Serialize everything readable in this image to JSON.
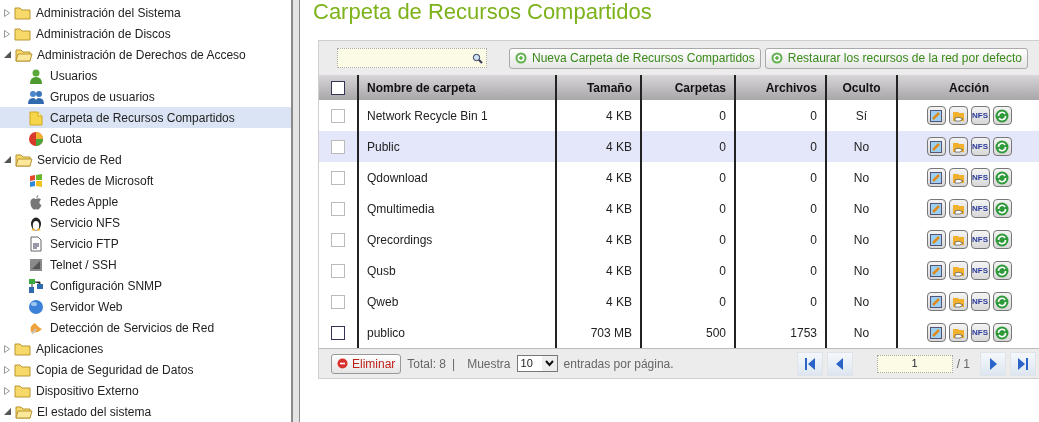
{
  "sidebar": {
    "items": [
      {
        "label": "Administración del Sistema",
        "expanded": false
      },
      {
        "label": "Administración de Discos",
        "expanded": false
      },
      {
        "label": "Administración de Derechos de Acceso",
        "expanded": true,
        "children": [
          {
            "label": "Usuarios",
            "kind": "user",
            "selected": false
          },
          {
            "label": "Grupos de usuarios",
            "kind": "group",
            "selected": false
          },
          {
            "label": "Carpeta de Recursos Compartidos",
            "kind": "folder",
            "selected": true
          },
          {
            "label": "Cuota",
            "kind": "quota",
            "selected": false
          }
        ]
      },
      {
        "label": "Servicio de Red",
        "expanded": true,
        "children": [
          {
            "label": "Redes de Microsoft",
            "kind": "windows",
            "selected": false
          },
          {
            "label": "Redes Apple",
            "kind": "apple",
            "selected": false
          },
          {
            "label": "Servicio NFS",
            "kind": "penguin",
            "selected": false
          },
          {
            "label": "Servicio FTP",
            "kind": "document",
            "selected": false
          },
          {
            "label": "Telnet / SSH",
            "kind": "terminal",
            "selected": false
          },
          {
            "label": "Configuración SNMP",
            "kind": "network",
            "selected": false
          },
          {
            "label": "Servidor Web",
            "kind": "globe",
            "selected": false
          },
          {
            "label": "Detección de Servicios de Red",
            "kind": "dish",
            "selected": false
          }
        ]
      },
      {
        "label": "Aplicaciones",
        "expanded": false
      },
      {
        "label": "Copia de Seguridad de Datos",
        "expanded": false
      },
      {
        "label": "Dispositivo Externo",
        "expanded": false
      },
      {
        "label": "El estado del sistema",
        "expanded": true
      }
    ]
  },
  "page_title": "Carpeta de Recursos Compartidos",
  "toolbar": {
    "buttons": [
      "Nueva Carpeta de Recursos Compartidos",
      "Restaurar los recursos de la red por defecto"
    ]
  },
  "table": {
    "select_all_checked": false,
    "columns": [
      "Nombre de carpeta",
      "Tamaño",
      "Carpetas",
      "Archivos",
      "Oculto",
      "Acción"
    ],
    "rows": [
      {
        "name": "Network Recycle Bin 1",
        "size": "4 KB",
        "folders": "0",
        "files": "0",
        "hidden": "Sí",
        "nfs_label": "NFS",
        "checked": false,
        "selected": false
      },
      {
        "name": "Public",
        "size": "4 KB",
        "folders": "0",
        "files": "0",
        "hidden": "No",
        "nfs_label": "NFS",
        "checked": false,
        "selected": true
      },
      {
        "name": "Qdownload",
        "size": "4 KB",
        "folders": "0",
        "files": "0",
        "hidden": "No",
        "nfs_label": "NFS",
        "checked": false,
        "selected": false
      },
      {
        "name": "Qmultimedia",
        "size": "4 KB",
        "folders": "0",
        "files": "0",
        "hidden": "No",
        "nfs_label": "NFS",
        "checked": false,
        "selected": false
      },
      {
        "name": "Qrecordings",
        "size": "4 KB",
        "folders": "0",
        "files": "0",
        "hidden": "No",
        "nfs_label": "NFS",
        "checked": false,
        "selected": false
      },
      {
        "name": "Qusb",
        "size": "4 KB",
        "folders": "0",
        "files": "0",
        "hidden": "No",
        "nfs_label": "NFS",
        "checked": false,
        "selected": false
      },
      {
        "name": "Qweb",
        "size": "4 KB",
        "folders": "0",
        "files": "0",
        "hidden": "No",
        "nfs_label": "NFS",
        "checked": false,
        "selected": false
      },
      {
        "name": "publico",
        "size": "703 MB",
        "folders": "500",
        "files": "1753",
        "hidden": "No",
        "nfs_label": "NFS",
        "checked": false,
        "selected": false
      }
    ]
  },
  "footer": {
    "delete_button": "Eliminar",
    "total": "Total: 8",
    "separator": "|",
    "show_label": "Muestra",
    "page_size": "10",
    "per_page_label": "entradas por página.",
    "page": "1",
    "page_count": "/ 1"
  }
}
